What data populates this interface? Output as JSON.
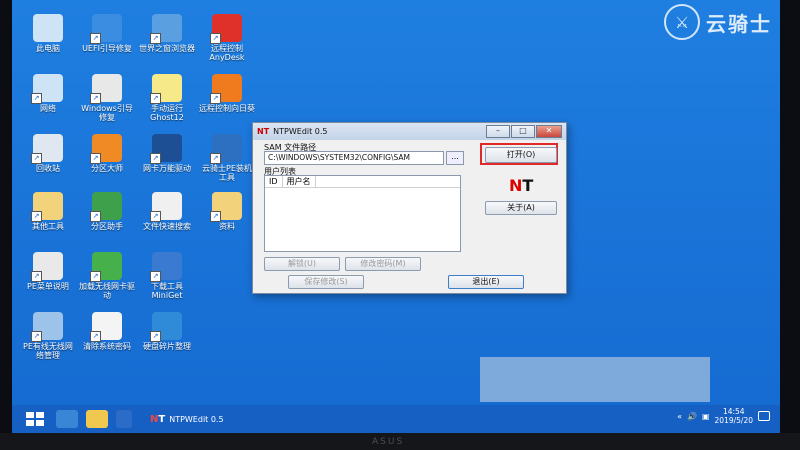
{
  "watermark": {
    "text": "云骑士",
    "logo": "knight-emblem-icon"
  },
  "desktop_icons": [
    {
      "label": "此电脑",
      "icon": "computer-icon",
      "color": "#cfe3f7"
    },
    {
      "label": "UEFI引导修复",
      "icon": "uefi-repair-icon",
      "color": "#3a8de0"
    },
    {
      "label": "世界之窗浏览器",
      "icon": "browser-globe-icon",
      "color": "#5aa0e0"
    },
    {
      "label": "远程控制AnyDesk",
      "icon": "anydesk-icon",
      "color": "#e0302a"
    },
    {
      "label": "网络",
      "icon": "network-icon",
      "color": "#cfe3f7"
    },
    {
      "label": "Windows引导修复",
      "icon": "windows-repair-icon",
      "color": "#e8e8e8"
    },
    {
      "label": "手动运行Ghost12",
      "icon": "ghost-icon",
      "color": "#f6e98a"
    },
    {
      "label": "远程控制向日葵",
      "icon": "sunflower-icon",
      "color": "#f07a1e"
    },
    {
      "label": "回收站",
      "icon": "recycle-bin-icon",
      "color": "#dfe8f0"
    },
    {
      "label": "分区大师",
      "icon": "partition-master-icon",
      "color": "#f08a24"
    },
    {
      "label": "网卡万能驱动",
      "icon": "nic-driver-icon",
      "color": "#1c4f94"
    },
    {
      "label": "云骑士PE装机工具",
      "icon": "yunqishi-installer-icon",
      "color": "#2d6fc0"
    },
    {
      "label": "其他工具",
      "icon": "folder-icon",
      "color": "#f2d27a"
    },
    {
      "label": "分区助手",
      "icon": "partition-assistant-icon",
      "color": "#3ea04a"
    },
    {
      "label": "文件快速搜索",
      "icon": "file-search-icon",
      "color": "#f0f0f0"
    },
    {
      "label": "资料",
      "icon": "documents-folder-icon",
      "color": "#f2d27a"
    },
    {
      "label": "PE菜单说明",
      "icon": "pe-readme-icon",
      "color": "#e9e9e9"
    },
    {
      "label": "加载无线网卡驱动",
      "icon": "wifi-signal-icon",
      "color": "#46b04a"
    },
    {
      "label": "下载工具MiniGet",
      "icon": "miniget-fish-icon",
      "color": "#3a7ad0"
    },
    {
      "label": "",
      "icon": "",
      "color": ""
    },
    {
      "label": "PE有线无线网络管理",
      "icon": "network-manager-icon",
      "color": "#9ec3e8"
    },
    {
      "label": "清除系统密码",
      "icon": "clear-password-icon",
      "color": "#f4f4f4"
    },
    {
      "label": "硬盘碎片整理",
      "icon": "defrag-icon",
      "color": "#2f8ad8"
    }
  ],
  "window": {
    "title": "NTPWEdit 0.5",
    "sam_label": "SAM 文件路径",
    "sam_path": "C:\\WINDOWS\\SYSTEM32\\CONFIG\\SAM",
    "browse_label": "...",
    "open_label": "打开(O)",
    "about_label": "关于(A)",
    "userlist_label": "用户列表",
    "columns": [
      "ID",
      "用户名"
    ],
    "unlock_label": "解锁(U)",
    "changepw_label": "修改密码(M)",
    "save_label": "保存修改(S)",
    "exit_label": "退出(E)",
    "logo_n": "N",
    "logo_t": "T"
  },
  "taskbar": {
    "app_label": "NTPWEdit 0.5",
    "time": "14:54",
    "date": "2019/5/20"
  },
  "colors": {
    "desktop": "#1b76da",
    "taskbar": "#1660c4",
    "highlight": "#e02a2a"
  }
}
